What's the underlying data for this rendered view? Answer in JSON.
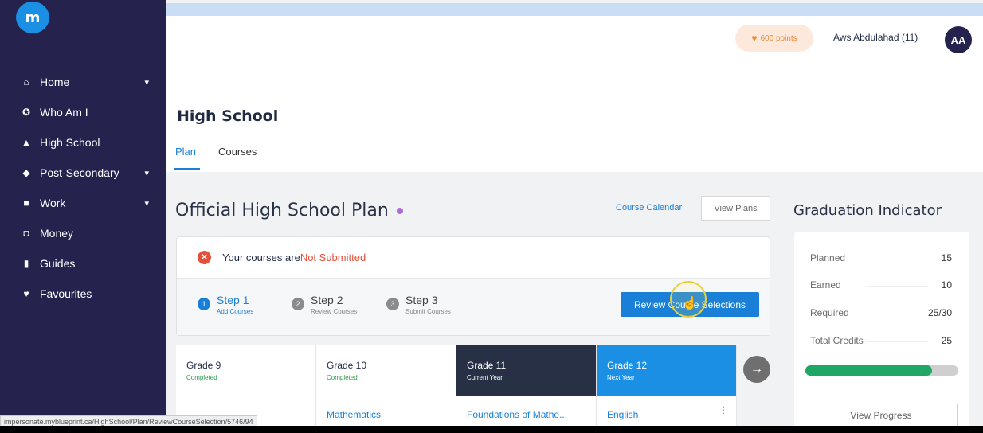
{
  "sidebar": {
    "logo": "m",
    "items": [
      {
        "label": "Home",
        "icon": "home-icon",
        "glyph": "⌂",
        "chevron": true
      },
      {
        "label": "Who Am I",
        "icon": "compass-icon",
        "glyph": "✪",
        "chevron": false
      },
      {
        "label": "High School",
        "icon": "school-icon",
        "glyph": "▲",
        "chevron": false
      },
      {
        "label": "Post-Secondary",
        "icon": "graduation-cap-icon",
        "glyph": "◆",
        "chevron": true
      },
      {
        "label": "Work",
        "icon": "briefcase-icon",
        "glyph": "■",
        "chevron": true
      },
      {
        "label": "Money",
        "icon": "money-icon",
        "glyph": "◘",
        "chevron": false
      },
      {
        "label": "Guides",
        "icon": "book-icon",
        "glyph": "▮",
        "chevron": false
      },
      {
        "label": "Favourites",
        "icon": "heart-icon",
        "glyph": "♥",
        "chevron": false
      }
    ]
  },
  "header": {
    "points": "600 points",
    "user_name": "Aws Abdulahad (11)",
    "avatar_initials": "AA"
  },
  "page": {
    "title": "High School",
    "tabs": [
      "Plan",
      "Courses"
    ]
  },
  "plan": {
    "title": "Official High School Plan",
    "course_calendar": "Course Calendar",
    "view_plans": "View Plans",
    "status_prefix": "Your courses are ",
    "status_value": "Not Submitted",
    "steps": [
      {
        "num": "1",
        "title": "Step 1",
        "sub": "Add Courses"
      },
      {
        "num": "2",
        "title": "Step 2",
        "sub": "Review Courses"
      },
      {
        "num": "3",
        "title": "Step 3",
        "sub": "Submit Courses"
      }
    ],
    "review_button": "Review Course Selections"
  },
  "grades": [
    {
      "name": "Grade 9",
      "status": "Completed",
      "course": ""
    },
    {
      "name": "Grade 10",
      "status": "Completed",
      "course": "Mathematics"
    },
    {
      "name": "Grade 11",
      "status": "Current Year",
      "course": "Foundations of Mathe..."
    },
    {
      "name": "Grade 12",
      "status": "Next Year",
      "course": "English"
    }
  ],
  "graduation": {
    "title": "Graduation Indicator",
    "rows": [
      {
        "label": "Planned",
        "value": "15"
      },
      {
        "label": "Earned",
        "value": "10"
      },
      {
        "label": "Required",
        "value": "25/30"
      },
      {
        "label": "Total Credits",
        "value": "25"
      }
    ],
    "progress_fraction": 0.83,
    "view_progress": "View Progress"
  },
  "statusbar_url": "impersonate.myblueprint.ca/HighSchool/Plan/ReviewCourseSelection/5746/94",
  "colors": {
    "sidebar_bg": "#25224e",
    "accent_blue": "#1a7fd6",
    "error_red": "#e5503a",
    "progress_green": "#1fa865"
  }
}
